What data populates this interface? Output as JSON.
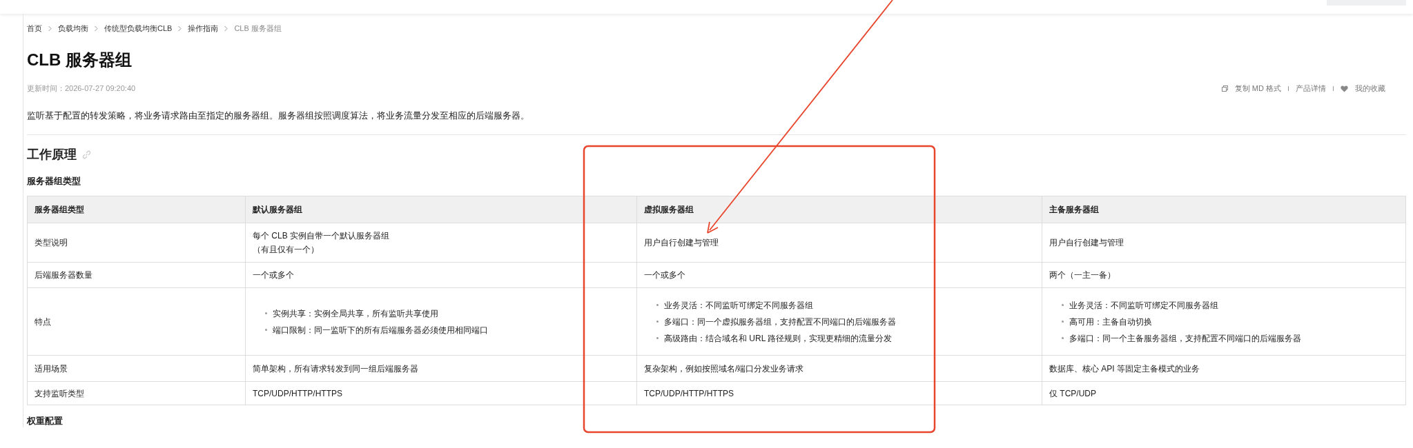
{
  "breadcrumb": [
    {
      "label": "首页",
      "current": false
    },
    {
      "label": "负载均衡",
      "current": false
    },
    {
      "label": "传统型负载均衡CLB",
      "current": false
    },
    {
      "label": "操作指南",
      "current": false
    },
    {
      "label": "CLB 服务器组",
      "current": true
    }
  ],
  "title": "CLB 服务器组",
  "updated": "更新时间：2026-07-27 09:20:40",
  "actions": [
    {
      "kind": "copy",
      "label": "复制 MD 格式"
    },
    {
      "kind": "plain",
      "label": "产品详情"
    },
    {
      "kind": "favorite",
      "label": "我的收藏"
    }
  ],
  "description": "监听基于配置的转发策略，将业务请求路由至指定的服务器组。服务器组按照调度算法，将业务流量分发至相应的后端服务器。",
  "section_title": "工作原理",
  "subsection_title": "服务器组类型",
  "table": {
    "columns": [
      "服务器组类型",
      "默认服务器组",
      "虚拟服务器组",
      "主备服务器组"
    ],
    "rows": [
      {
        "cells": [
          {
            "kind": "text",
            "lines": [
              "类型说明"
            ]
          },
          {
            "kind": "text",
            "lines": [
              "每个 CLB 实例自带一个默认服务器组",
              "（有且仅有一个）"
            ]
          },
          {
            "kind": "text",
            "lines": [
              "用户自行创建与管理"
            ]
          },
          {
            "kind": "text",
            "lines": [
              "用户自行创建与管理"
            ]
          }
        ]
      },
      {
        "cells": [
          {
            "kind": "text",
            "lines": [
              "后端服务器数量"
            ]
          },
          {
            "kind": "text",
            "lines": [
              "一个或多个"
            ]
          },
          {
            "kind": "text",
            "lines": [
              "一个或多个"
            ]
          },
          {
            "kind": "text",
            "lines": [
              "两个（一主一备）"
            ]
          }
        ]
      },
      {
        "cells": [
          {
            "kind": "text",
            "lines": [
              "特点"
            ]
          },
          {
            "kind": "list",
            "lines": [
              "实例共享：实例全局共享，所有监听共享使用",
              "端口限制：同一监听下的所有后端服务器必须使用相同端口"
            ]
          },
          {
            "kind": "list",
            "lines": [
              "业务灵活：不同监听可绑定不同服务器组",
              "多端口：同一个虚拟服务器组，支持配置不同端口的后端服务器",
              "高级路由：结合域名和 URL 路径规则，实现更精细的流量分发"
            ]
          },
          {
            "kind": "list",
            "lines": [
              "业务灵活：不同监听可绑定不同服务器组",
              "高可用：主备自动切换",
              "多端口：同一个主备服务器组，支持配置不同端口的后端服务器"
            ]
          }
        ]
      },
      {
        "cells": [
          {
            "kind": "text",
            "lines": [
              "适用场景"
            ]
          },
          {
            "kind": "text",
            "lines": [
              "简单架构，所有请求转发到同一组后端服务器"
            ]
          },
          {
            "kind": "text",
            "lines": [
              "复杂架构，例如按照域名/端口分发业务请求"
            ]
          },
          {
            "kind": "text",
            "lines": [
              "数据库、核心 API 等固定主备模式的业务"
            ]
          }
        ]
      },
      {
        "cells": [
          {
            "kind": "text",
            "lines": [
              "支持监听类型"
            ]
          },
          {
            "kind": "text",
            "lines": [
              "TCP/UDP/HTTP/HTTPS"
            ]
          },
          {
            "kind": "text",
            "lines": [
              "TCP/UDP/HTTP/HTTPS"
            ]
          },
          {
            "kind": "text",
            "lines": [
              "仅 TCP/UDP"
            ]
          }
        ]
      }
    ]
  },
  "next_heading": "权重配置"
}
